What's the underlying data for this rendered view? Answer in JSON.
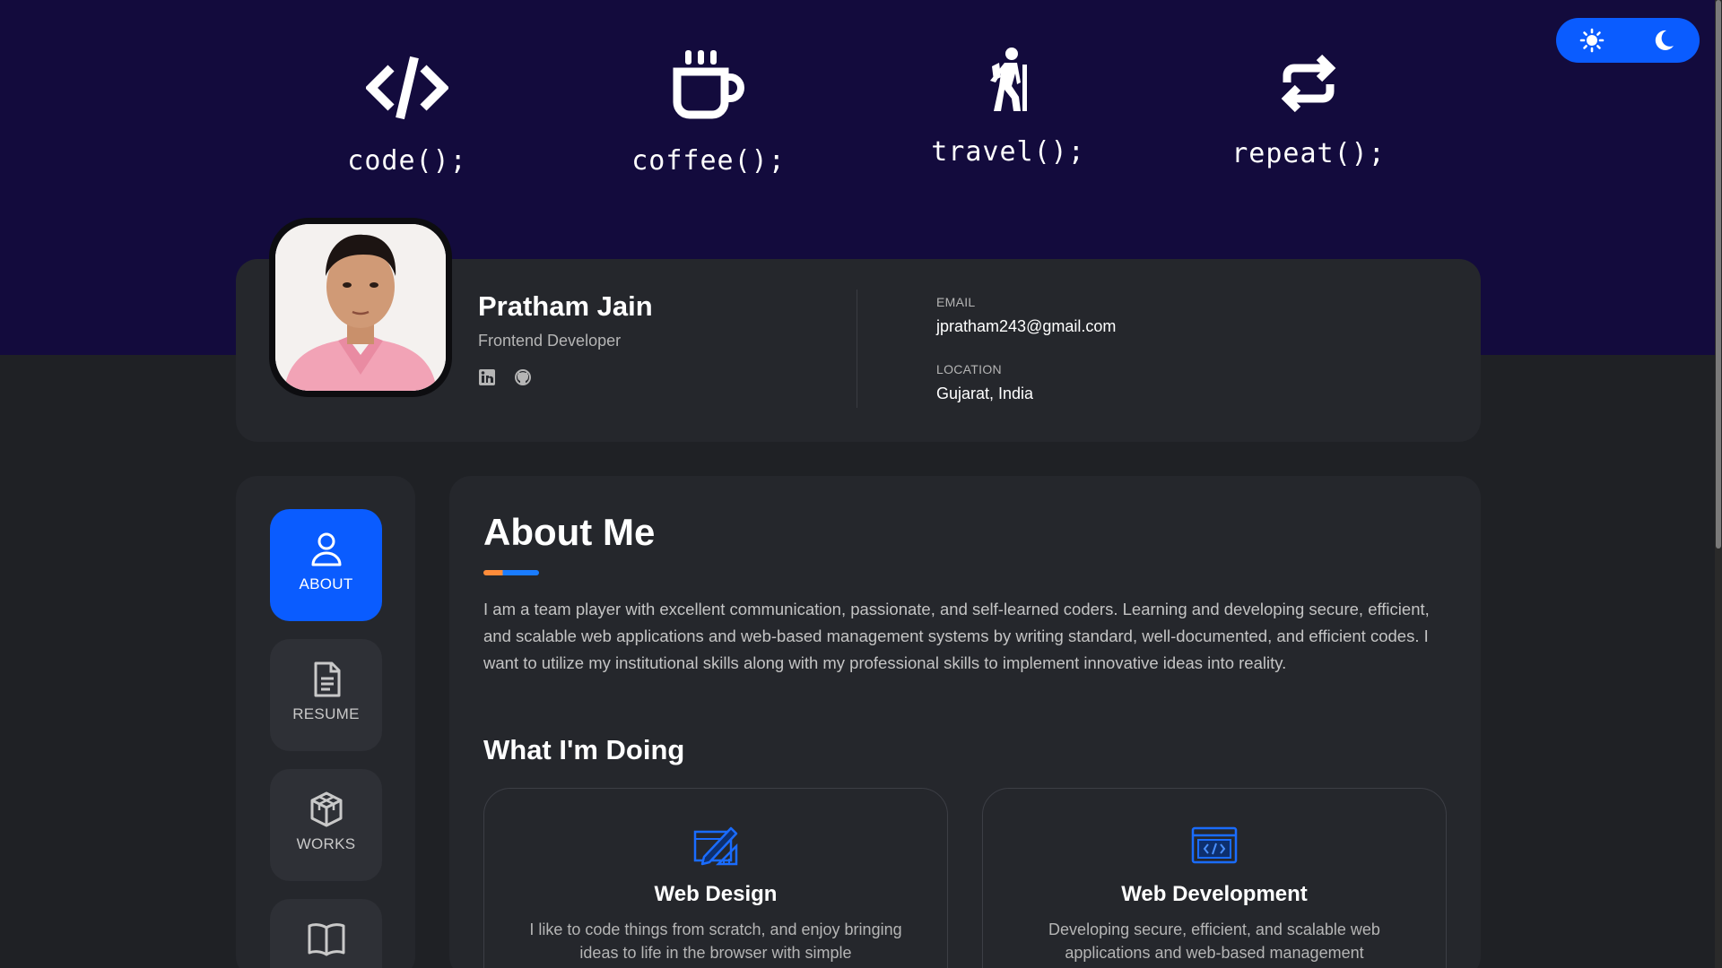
{
  "hobbies": [
    {
      "icon": "code-icon",
      "label": "code();"
    },
    {
      "icon": "coffee-icon",
      "label": "coffee();"
    },
    {
      "icon": "hiking-icon",
      "label": "travel();"
    },
    {
      "icon": "repeat-icon",
      "label": "repeat();"
    }
  ],
  "theme_toggle": {
    "light_icon": "sun-icon",
    "dark_icon": "moon-icon",
    "accent": "#0a5cff"
  },
  "profile": {
    "name": "Pratham Jain",
    "role": "Frontend Developer",
    "socials": [
      "linkedin-icon",
      "github-icon"
    ],
    "email_label": "EMAIL",
    "email": "jpratham243@gmail.com",
    "location_label": "LOCATION",
    "location": "Gujarat, India"
  },
  "nav": {
    "items": [
      {
        "label": "ABOUT",
        "icon": "user-icon",
        "active": true
      },
      {
        "label": "RESUME",
        "icon": "document-icon",
        "active": false
      },
      {
        "label": "WORKS",
        "icon": "cube-icon",
        "active": false
      },
      {
        "label": "",
        "icon": "book-icon",
        "active": false
      }
    ]
  },
  "about": {
    "title": "About Me",
    "text": "I am a team player with excellent communication, passionate, and self-learned coders. Learning and developing secure, efficient, and scalable web applications and web-based management systems by writing standard, well-documented, and efficient codes. I want to utilize my institutional skills along with my professional skills to implement innovative ideas into reality.",
    "doing_title": "What I'm Doing",
    "services": [
      {
        "icon": "design-icon",
        "title": "Web Design",
        "desc": "I like to code things from scratch, and enjoy bringing ideas to life in the browser with simple"
      },
      {
        "icon": "web-dev-icon",
        "title": "Web Development",
        "desc": "Developing secure, efficient, and scalable web applications and web-based management"
      }
    ]
  },
  "colors": {
    "hero_bg": "#130b3d",
    "page_bg": "#1f2125",
    "card_bg": "#25272c",
    "accent_blue": "#0a5cff",
    "accent_orange": "#ff8c3a"
  }
}
